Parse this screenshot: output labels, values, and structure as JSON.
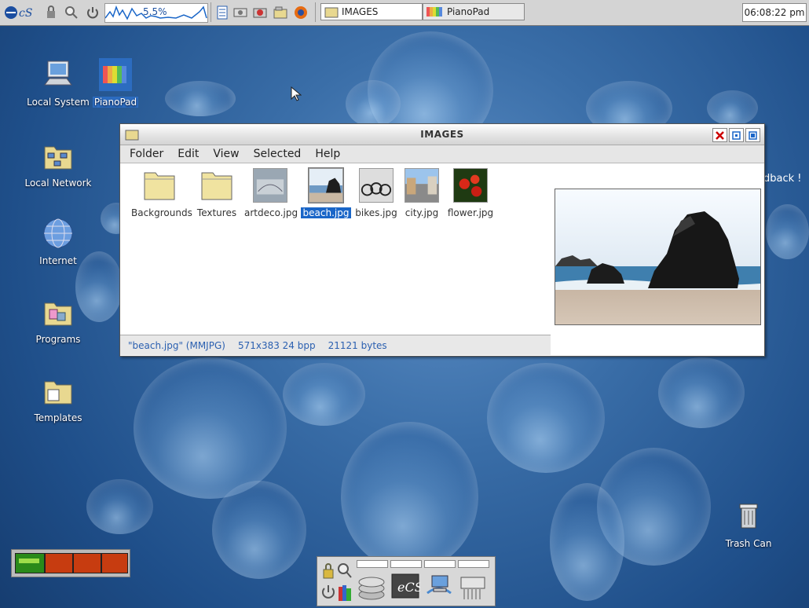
{
  "taskbar": {
    "cpu_percent": "5.5%",
    "tasks": [
      {
        "label": "IMAGES"
      },
      {
        "label": "PianoPad"
      }
    ],
    "clock": "06:08:22 pm"
  },
  "desktop": {
    "icons": [
      {
        "label": "Local System"
      },
      {
        "label": "PianoPad"
      },
      {
        "label": "Local Network"
      },
      {
        "label": "Internet"
      },
      {
        "label": "Programs"
      },
      {
        "label": "Templates"
      },
      {
        "label": "Trash Can"
      }
    ],
    "partial_text": "dback !"
  },
  "window": {
    "title": "IMAGES",
    "menu": [
      "Folder",
      "Edit",
      "View",
      "Selected",
      "Help"
    ],
    "files": [
      {
        "name": "Backgrounds"
      },
      {
        "name": "Textures"
      },
      {
        "name": "artdeco.jpg"
      },
      {
        "name": "beach.jpg"
      },
      {
        "name": "bikes.jpg"
      },
      {
        "name": "city.jpg"
      },
      {
        "name": "flower.jpg"
      }
    ],
    "selected_file": "beach.jpg",
    "status": {
      "file": "\"beach.jpg\" (MMJPG)",
      "dims": "571x383 24 bpp",
      "size": "21121 bytes"
    }
  },
  "colors": {
    "selection": "#1a66c8",
    "status_text": "#2a5fb0",
    "desktop_blue": "#2f63a0"
  }
}
